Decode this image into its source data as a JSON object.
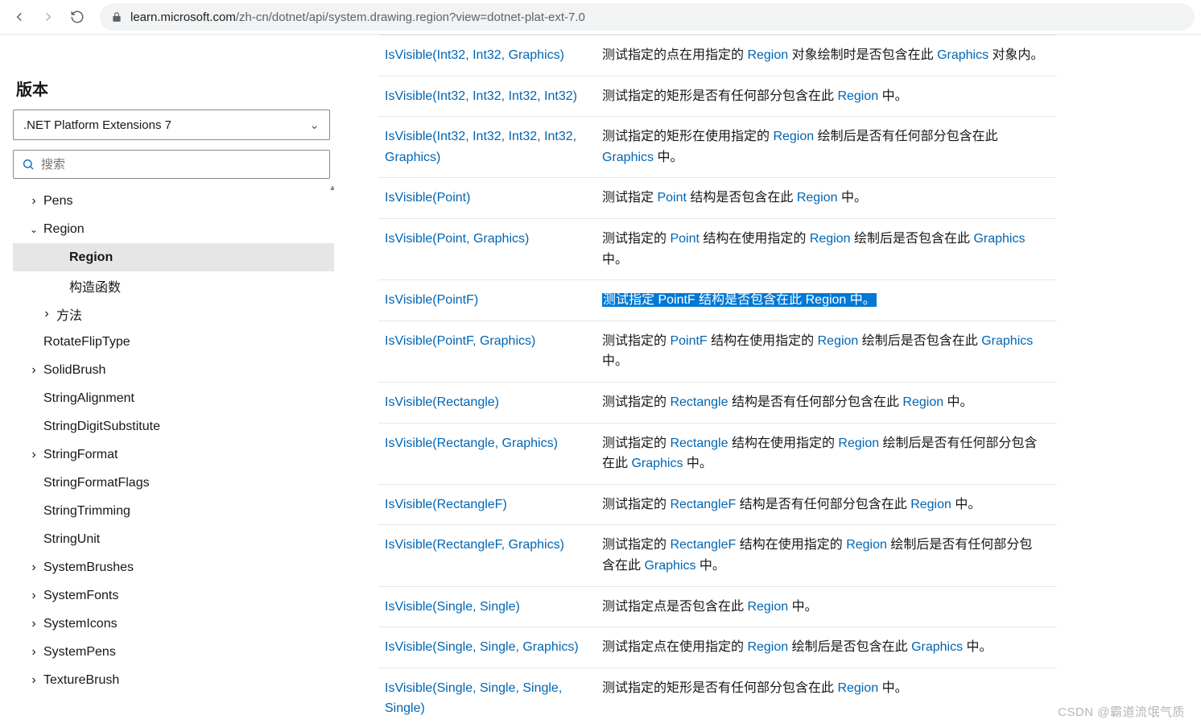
{
  "browser": {
    "url_host": "learn.microsoft.com",
    "url_path": "/zh-cn/dotnet/api/system.drawing.region?view=dotnet-plat-ext-7.0"
  },
  "sidebar": {
    "version_label": "版本",
    "version_value": ".NET Platform Extensions 7",
    "search_placeholder": "搜索",
    "tree": [
      {
        "label": "Pens",
        "expander": "right",
        "level": 0,
        "selected": false
      },
      {
        "label": "Region",
        "expander": "down",
        "level": 0,
        "selected": false
      },
      {
        "label": "Region",
        "expander": "none",
        "level": 2,
        "selected": true
      },
      {
        "label": "构造函数",
        "expander": "none",
        "level": 2,
        "selected": false
      },
      {
        "label": "方法",
        "expander": "right",
        "level": 1,
        "selected": false
      },
      {
        "label": "RotateFlipType",
        "expander": "none",
        "level": 0,
        "selected": false
      },
      {
        "label": "SolidBrush",
        "expander": "right",
        "level": 0,
        "selected": false
      },
      {
        "label": "StringAlignment",
        "expander": "none",
        "level": 0,
        "selected": false
      },
      {
        "label": "StringDigitSubstitute",
        "expander": "none",
        "level": 0,
        "selected": false
      },
      {
        "label": "StringFormat",
        "expander": "right",
        "level": 0,
        "selected": false
      },
      {
        "label": "StringFormatFlags",
        "expander": "none",
        "level": 0,
        "selected": false
      },
      {
        "label": "StringTrimming",
        "expander": "none",
        "level": 0,
        "selected": false
      },
      {
        "label": "StringUnit",
        "expander": "none",
        "level": 0,
        "selected": false
      },
      {
        "label": "SystemBrushes",
        "expander": "right",
        "level": 0,
        "selected": false
      },
      {
        "label": "SystemFonts",
        "expander": "right",
        "level": 0,
        "selected": false
      },
      {
        "label": "SystemIcons",
        "expander": "right",
        "level": 0,
        "selected": false
      },
      {
        "label": "SystemPens",
        "expander": "right",
        "level": 0,
        "selected": false
      },
      {
        "label": "TextureBrush",
        "expander": "right",
        "level": 0,
        "selected": false
      }
    ]
  },
  "table": {
    "rows": [
      {
        "sig": "IsVisible(Int32, Int32, Graphics)",
        "desc": [
          {
            "t": "测试指定的点在用指定的 "
          },
          {
            "t": "Region",
            "link": true
          },
          {
            "t": " 对象绘制时是否包含在此 "
          },
          {
            "t": "Graphics",
            "link": true
          },
          {
            "t": " 对象内。"
          }
        ]
      },
      {
        "sig": "IsVisible(Int32, Int32, Int32, Int32)",
        "desc": [
          {
            "t": "测试指定的矩形是否有任何部分包含在此 "
          },
          {
            "t": "Region",
            "link": true
          },
          {
            "t": " 中。"
          }
        ]
      },
      {
        "sig": "IsVisible(Int32, Int32, Int32, Int32, Graphics)",
        "desc": [
          {
            "t": "测试指定的矩形在使用指定的 "
          },
          {
            "t": "Region",
            "link": true
          },
          {
            "t": " 绘制后是否有任何部分包含在此 "
          },
          {
            "t": "Graphics",
            "link": true
          },
          {
            "t": " 中。"
          }
        ]
      },
      {
        "sig": "IsVisible(Point)",
        "desc": [
          {
            "t": "测试指定 "
          },
          {
            "t": "Point",
            "link": true
          },
          {
            "t": " 结构是否包含在此 "
          },
          {
            "t": "Region",
            "link": true
          },
          {
            "t": " 中。"
          }
        ]
      },
      {
        "sig": "IsVisible(Point, Graphics)",
        "desc": [
          {
            "t": "测试指定的 "
          },
          {
            "t": "Point",
            "link": true
          },
          {
            "t": " 结构在使用指定的 "
          },
          {
            "t": "Region",
            "link": true
          },
          {
            "t": " 绘制后是否包含在此 "
          },
          {
            "t": "Graphics",
            "link": true
          },
          {
            "t": " 中。"
          }
        ]
      },
      {
        "sig": "IsVisible(PointF)",
        "highlight": true,
        "desc": [
          {
            "t": "测试指定 "
          },
          {
            "t": "PointF",
            "link": true
          },
          {
            "t": " 结构是否包含在此 "
          },
          {
            "t": "Region",
            "link": true
          },
          {
            "t": " 中。"
          }
        ]
      },
      {
        "sig": "IsVisible(PointF, Graphics)",
        "desc": [
          {
            "t": "测试指定的 "
          },
          {
            "t": "PointF",
            "link": true
          },
          {
            "t": " 结构在使用指定的 "
          },
          {
            "t": "Region",
            "link": true
          },
          {
            "t": " 绘制后是否包含在此 "
          },
          {
            "t": "Graphics",
            "link": true
          },
          {
            "t": " 中。"
          }
        ]
      },
      {
        "sig": "IsVisible(Rectangle)",
        "desc": [
          {
            "t": "测试指定的 "
          },
          {
            "t": "Rectangle",
            "link": true
          },
          {
            "t": " 结构是否有任何部分包含在此 "
          },
          {
            "t": "Region",
            "link": true
          },
          {
            "t": " 中。"
          }
        ]
      },
      {
        "sig": "IsVisible(Rectangle, Graphics)",
        "desc": [
          {
            "t": "测试指定的 "
          },
          {
            "t": "Rectangle",
            "link": true
          },
          {
            "t": " 结构在使用指定的 "
          },
          {
            "t": "Region",
            "link": true
          },
          {
            "t": " 绘制后是否有任何部分包含在此 "
          },
          {
            "t": "Graphics",
            "link": true
          },
          {
            "t": " 中。"
          }
        ]
      },
      {
        "sig": "IsVisible(RectangleF)",
        "desc": [
          {
            "t": "测试指定的 "
          },
          {
            "t": "RectangleF",
            "link": true
          },
          {
            "t": " 结构是否有任何部分包含在此 "
          },
          {
            "t": "Region",
            "link": true
          },
          {
            "t": " 中。"
          }
        ]
      },
      {
        "sig": "IsVisible(RectangleF, Graphics)",
        "desc": [
          {
            "t": "测试指定的 "
          },
          {
            "t": "RectangleF",
            "link": true
          },
          {
            "t": " 结构在使用指定的 "
          },
          {
            "t": "Region",
            "link": true
          },
          {
            "t": " 绘制后是否有任何部分包含在此 "
          },
          {
            "t": "Graphics",
            "link": true
          },
          {
            "t": " 中。"
          }
        ]
      },
      {
        "sig": "IsVisible(Single, Single)",
        "desc": [
          {
            "t": "测试指定点是否包含在此 "
          },
          {
            "t": "Region",
            "link": true
          },
          {
            "t": " 中。"
          }
        ]
      },
      {
        "sig": "IsVisible(Single, Single, Graphics)",
        "desc": [
          {
            "t": "测试指定点在使用指定的 "
          },
          {
            "t": "Region",
            "link": true
          },
          {
            "t": " 绘制后是否包含在此 "
          },
          {
            "t": "Graphics",
            "link": true
          },
          {
            "t": " 中。"
          }
        ]
      },
      {
        "sig": "IsVisible(Single, Single, Single, Single)",
        "desc": [
          {
            "t": "测试指定的矩形是否有任何部分包含在此 "
          },
          {
            "t": "Region",
            "link": true
          },
          {
            "t": " 中。"
          }
        ]
      }
    ]
  },
  "watermark": "CSDN @霸道流氓气质"
}
